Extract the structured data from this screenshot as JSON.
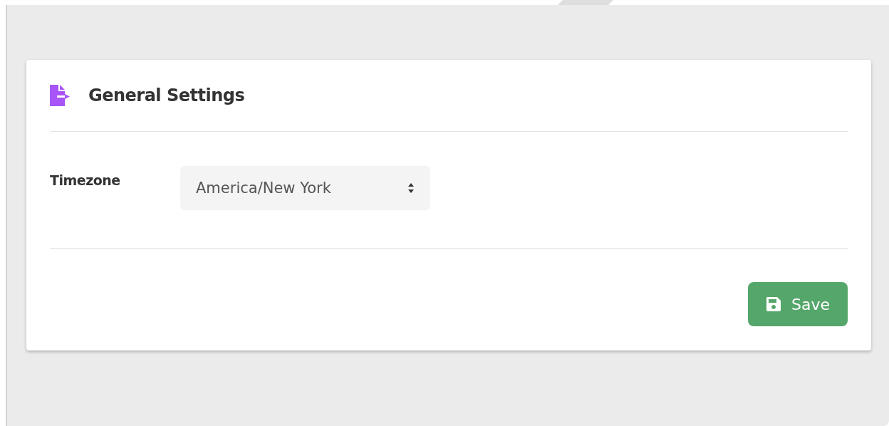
{
  "card": {
    "title": "General Settings"
  },
  "fields": [
    {
      "label": "Timezone",
      "value": "America/New York"
    }
  ],
  "buttons": [
    {
      "label": "Save"
    }
  ]
}
